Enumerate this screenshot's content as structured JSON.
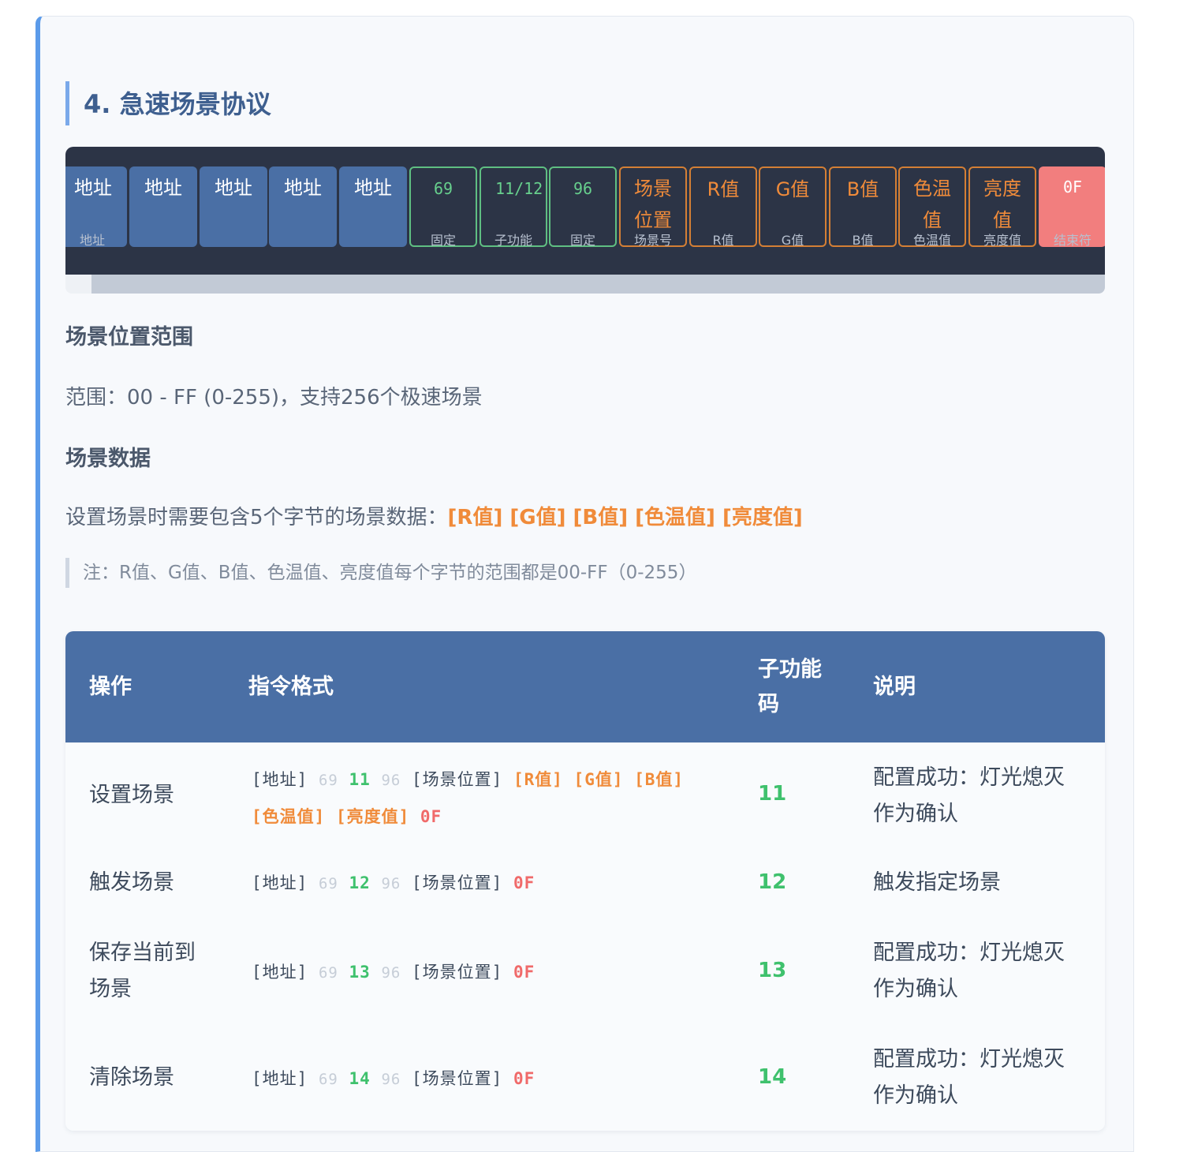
{
  "heading": "4. 急速场景协议",
  "diagram": {
    "addr_label": "地址",
    "addr_bottom": "地址",
    "fixed1": "69",
    "fixed1_label": "固定",
    "sub": "11/12",
    "sub_label": "子功能",
    "fixed2": "96",
    "fixed2_label": "固定",
    "scene_pos_1": "场景",
    "scene_pos_2": "位置",
    "scene_pos_label": "场景号",
    "r": "R值",
    "r_label": "R值",
    "g": "G值",
    "g_label": "G值",
    "b": "B值",
    "b_label": "B值",
    "ct_1": "色温",
    "ct_2": "值",
    "ct_label": "色温值",
    "br_1": "亮度",
    "br_2": "值",
    "br_label": "亮度值",
    "end": "0F",
    "end_label": "结束符"
  },
  "sections": {
    "range_title": "场景位置范围",
    "range_text": "范围：00 - FF (0-255)，支持256个极速场景",
    "data_title": "场景数据",
    "data_text": "设置场景时需要包含5个字节的场景数据：",
    "data_highlight": "[R值] [G值] [B值] [色温值] [亮度值]",
    "note": "注：R值、G值、B值、色温值、亮度值每个字节的范围都是00-FF（0-255）"
  },
  "table": {
    "headers": {
      "op": "操作",
      "format": "指令格式",
      "code_1": "子功能",
      "code_2": "码",
      "desc": "说明"
    },
    "tokens": {
      "addr": "[地址]",
      "fixed1": "69",
      "fixed2": "96",
      "pos": "[场景位置]",
      "end": "0F",
      "r": "[R值]",
      "g": "[G值]",
      "b": "[B值]",
      "ct": "[色温值]",
      "br": "[亮度值]"
    },
    "rows": [
      {
        "op": "设置场景",
        "code": "11",
        "desc_1": "配置成功：灯光熄灭",
        "desc_2": "作为确认"
      },
      {
        "op": "触发场景",
        "code": "12",
        "desc_1": "触发指定场景"
      },
      {
        "op_1": "保存当前到",
        "op_2": "场景",
        "code": "13",
        "desc_1": "配置成功：灯光熄灭",
        "desc_2": "作为确认"
      },
      {
        "op": "清除场景",
        "code": "14",
        "desc_1": "配置成功：灯光熄灭",
        "desc_2": "作为确认"
      }
    ]
  },
  "colors": {
    "accent": "#4a6fa5",
    "orange": "#f08b3a",
    "green": "#3fc16d",
    "red": "#f27e7e",
    "dark": "#2c3446"
  }
}
